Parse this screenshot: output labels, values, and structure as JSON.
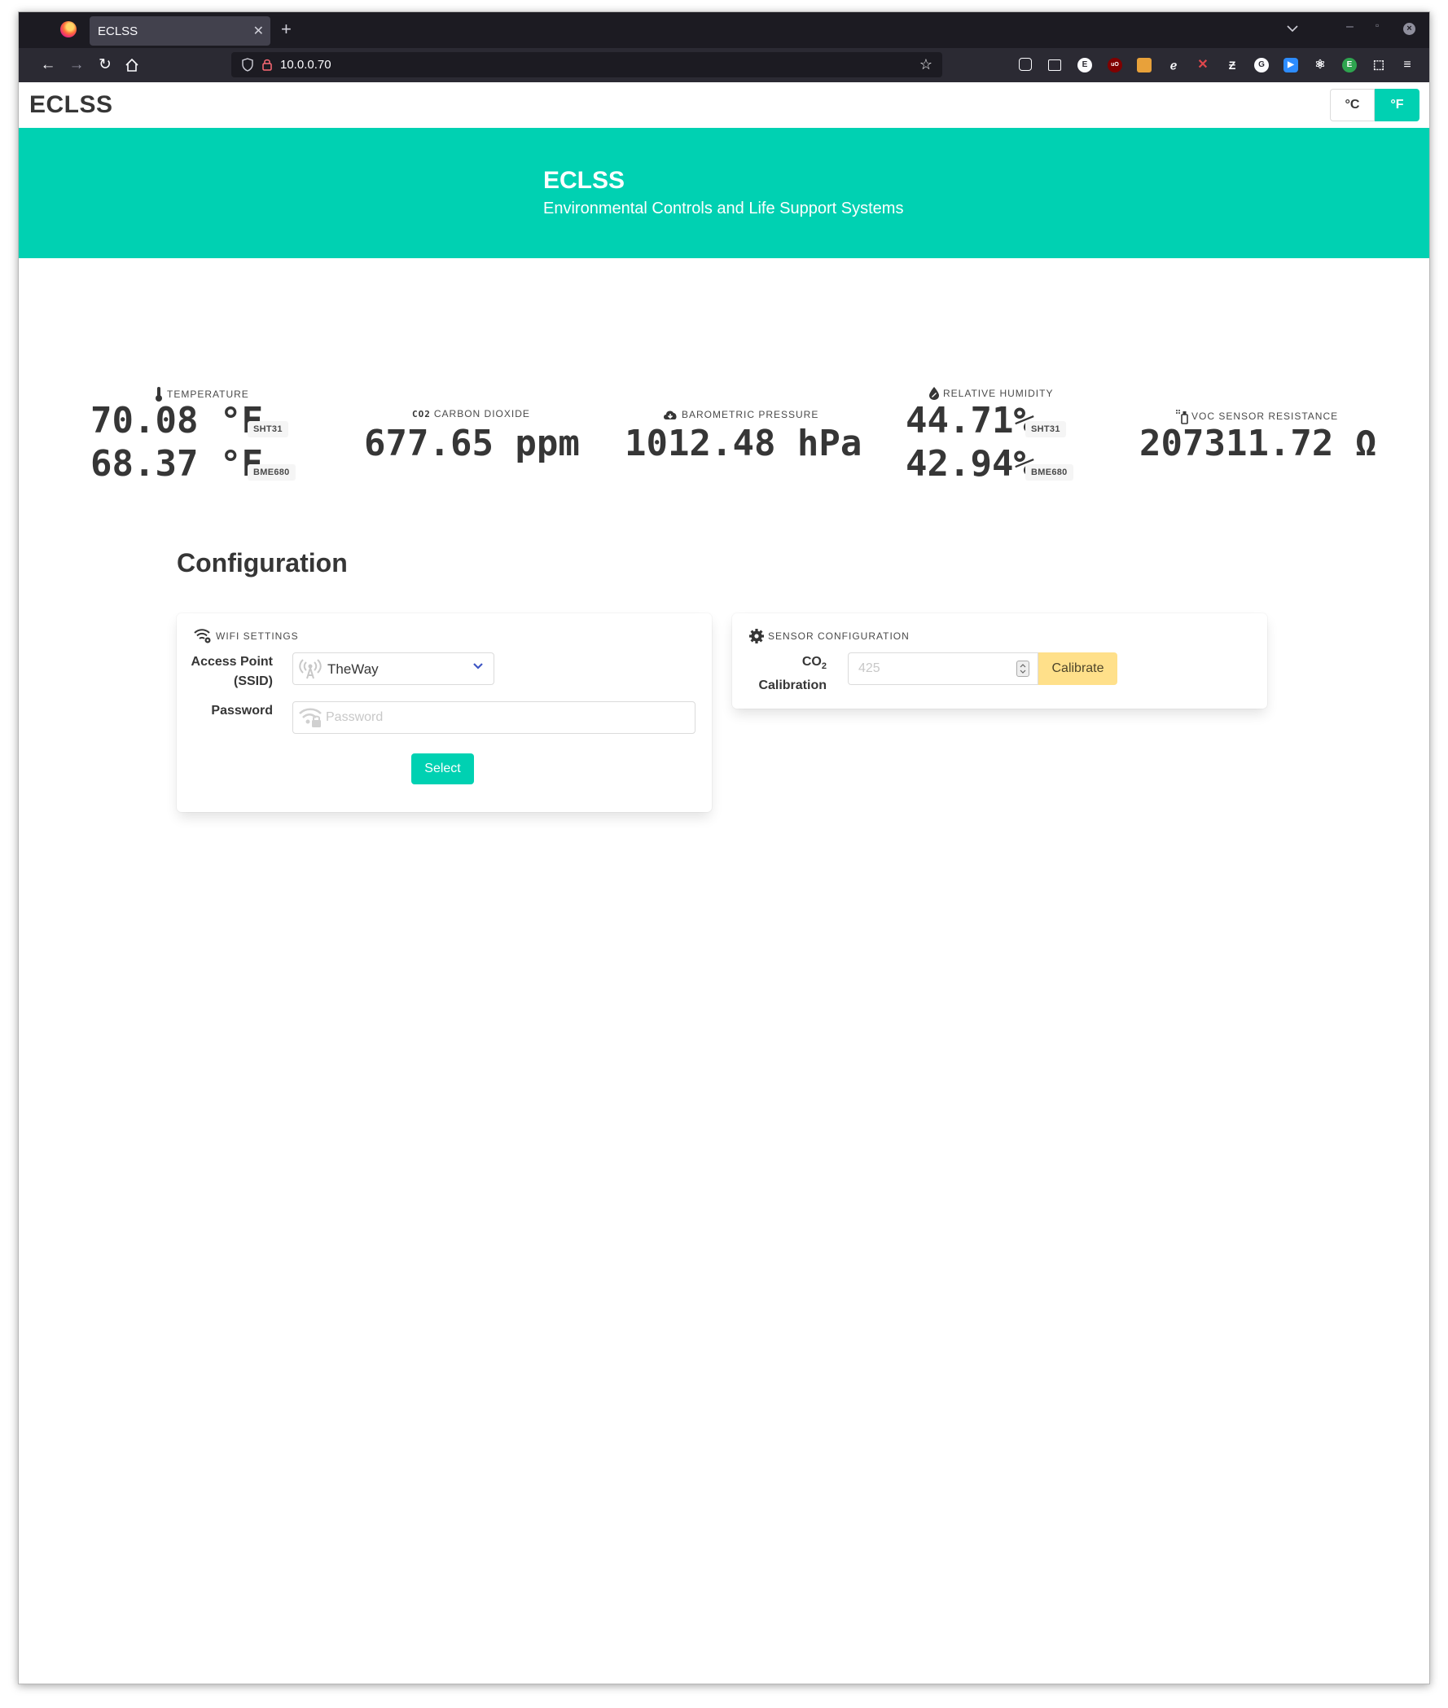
{
  "browser": {
    "tab_title": "ECLSS",
    "url": "10.0.0.70",
    "extensions": [
      "pocket-icon",
      "reader-icon",
      "e-icon",
      "ublock-icon",
      "ext-badge-icon",
      "bird-icon",
      "blocked-icon",
      "z-icon",
      "g-icon",
      "zoom-icon",
      "react-icon",
      "e-green-icon",
      "puzzle-icon",
      "menu-icon"
    ]
  },
  "navbar": {
    "brand": "ECLSS",
    "units": {
      "celsius": "°C",
      "fahrenheit": "°F",
      "selected": "°F"
    }
  },
  "hero": {
    "title": "ECLSS",
    "subtitle": "Environmental Controls and Life Support Systems"
  },
  "metrics": {
    "temperature": {
      "label": "TEMPERATURE",
      "readings": [
        {
          "value": "70.08 °F",
          "sensor": "SHT31"
        },
        {
          "value": "68.37 °F",
          "sensor": "BME680"
        }
      ]
    },
    "co2": {
      "icon_text": "CO2",
      "label": "CARBON DIOXIDE",
      "value": "677.65 ppm"
    },
    "pressure": {
      "label": "BAROMETRIC PRESSURE",
      "value": "1012.48 hPa"
    },
    "humidity": {
      "label": "RELATIVE HUMIDITY",
      "readings": [
        {
          "value": "44.71%",
          "sensor": "SHT31"
        },
        {
          "value": "42.94%",
          "sensor": "BME680"
        }
      ]
    },
    "voc": {
      "label": "VOC SENSOR RESISTANCE",
      "value": "207311.72 Ω"
    }
  },
  "configuration": {
    "title": "Configuration",
    "wifi": {
      "heading": "WIFI SETTINGS",
      "ssid_label_line1": "Access Point",
      "ssid_label_line2": "(SSID)",
      "ssid_value": "TheWay",
      "password_label": "Password",
      "password_placeholder": "Password",
      "select_label": "Select"
    },
    "sensor": {
      "heading": "SENSOR CONFIGURATION",
      "co2_label": "CO",
      "co2_sub": "2",
      "calibration_label": "Calibration",
      "calibration_placeholder": "425",
      "calibrate_label": "Calibrate"
    }
  },
  "colors": {
    "primary": "#00d1b2",
    "warning": "#ffe08a",
    "chrome_dark": "#1c1b22",
    "chrome_toolbar": "#2b2a33",
    "text": "#363636"
  }
}
